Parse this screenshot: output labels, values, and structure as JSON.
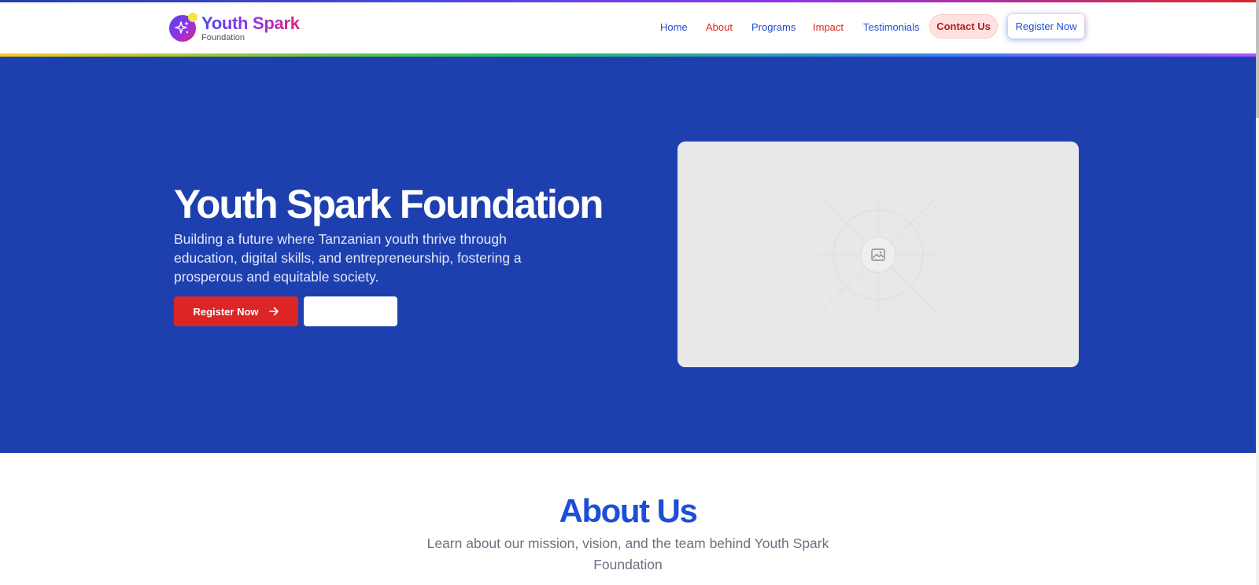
{
  "brand": {
    "name": "Youth Spark",
    "tagline": "Foundation"
  },
  "nav": {
    "home": "Home",
    "about": "About",
    "programs": "Programs",
    "impact": "Impact",
    "testimonials": "Testimonials",
    "contact": "Contact Us",
    "register": "Register Now"
  },
  "hero": {
    "title": "Youth Spark Foundation",
    "description": "Building a future where Tanzanian youth thrive through education, digital skills, and entrepreneurship, fostering a prosperous and equitable society.",
    "primary_button": "Register Now",
    "primary_button_icon": "arrow-right-icon",
    "image_icon": "image-placeholder-icon"
  },
  "about": {
    "title": "About Us",
    "subtitle": "Learn about our mission, vision, and the team behind Youth Spark Foundation"
  },
  "colors": {
    "primary_blue": "#1e40af",
    "accent_red": "#dc2626",
    "link_blue": "#1d4ed8"
  }
}
